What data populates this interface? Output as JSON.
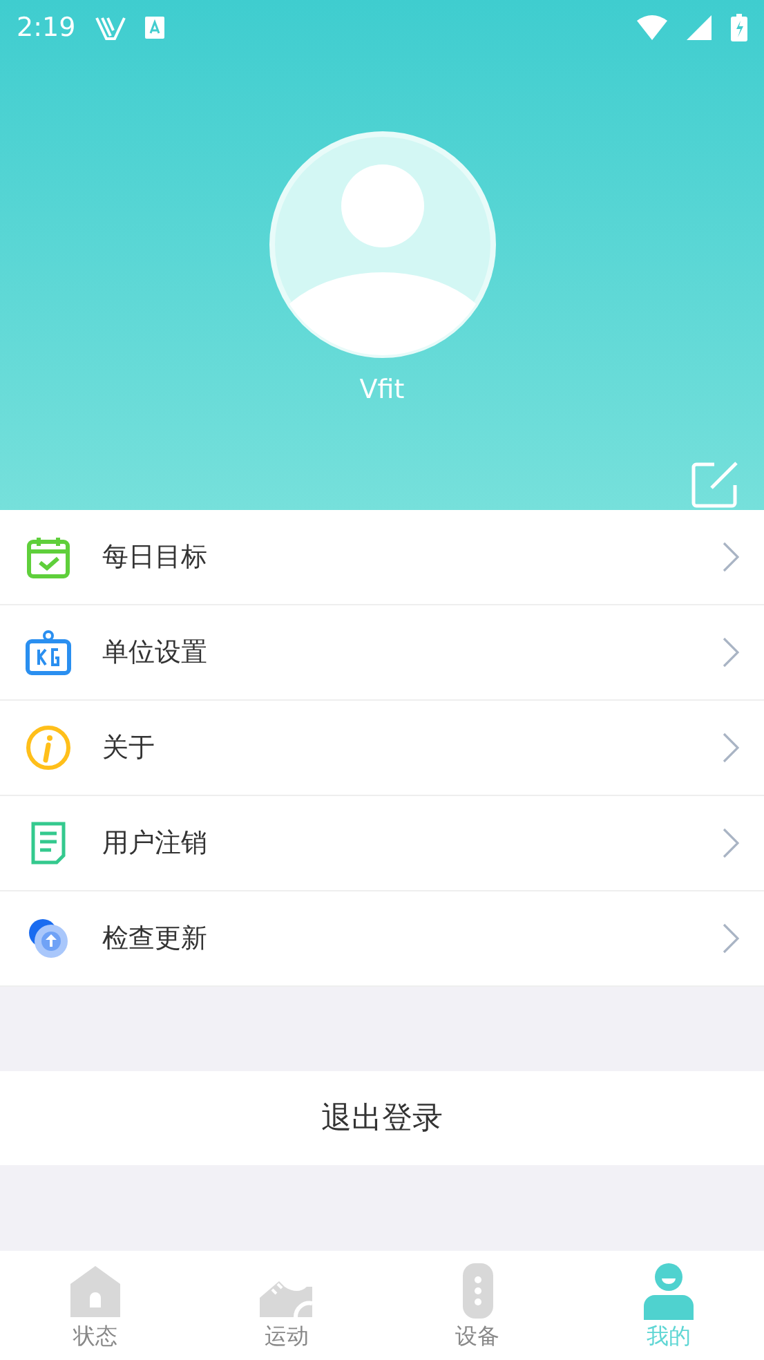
{
  "status_bar": {
    "time": "2:19"
  },
  "profile": {
    "name": "Vfit"
  },
  "menu": [
    {
      "kind": "calendar",
      "label": "每日目标"
    },
    {
      "kind": "scale",
      "label": "单位设置"
    },
    {
      "kind": "info",
      "label": "关于"
    },
    {
      "kind": "document",
      "label": "用户注销"
    },
    {
      "kind": "update",
      "label": "检查更新"
    }
  ],
  "logout": "退出登录",
  "tabs": [
    {
      "kind": "home",
      "label": "状态",
      "selected": false
    },
    {
      "kind": "shoe",
      "label": "运动",
      "selected": false
    },
    {
      "kind": "watch",
      "label": "设备",
      "selected": false
    },
    {
      "kind": "person",
      "label": "我的",
      "selected": true
    }
  ]
}
